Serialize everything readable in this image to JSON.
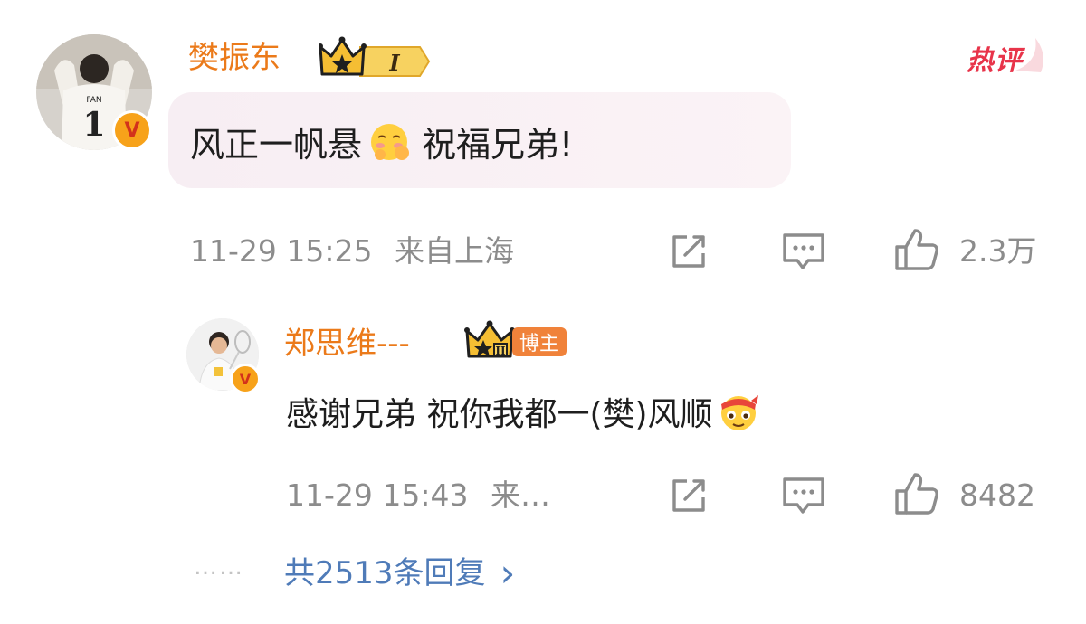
{
  "comment": {
    "username": "樊振东",
    "level_badge": "I",
    "hot_tag": "热评",
    "text": "风正一帆悬",
    "text_after_emoji": "祝福兄弟!",
    "timestamp": "11-29 15:25",
    "location": "来自上海",
    "like_count": "2.3万"
  },
  "reply": {
    "username": "郑思维---",
    "author_badge": "博主",
    "text": "感谢兄弟 祝你我都一(樊)风顺",
    "timestamp": "11-29 15:43",
    "location": "来…",
    "like_count": "8482"
  },
  "more_replies": {
    "dots": "……",
    "label": "共2513条回复",
    "chevron": "›"
  },
  "avatar_jersey": {
    "name": "FAN",
    "number": "1"
  },
  "colors": {
    "username": "#eb7a1a",
    "hot_tag": "#e8344a",
    "meta": "#8c8c8c",
    "link": "#4f7bb8",
    "bubble": "#f7eef3"
  },
  "icons": [
    "verified-v-icon",
    "crown-level-icon",
    "share-icon",
    "comment-icon",
    "thumbs-up-icon",
    "shy-emoji-icon",
    "blessing-emoji-icon",
    "chevron-right-icon"
  ]
}
